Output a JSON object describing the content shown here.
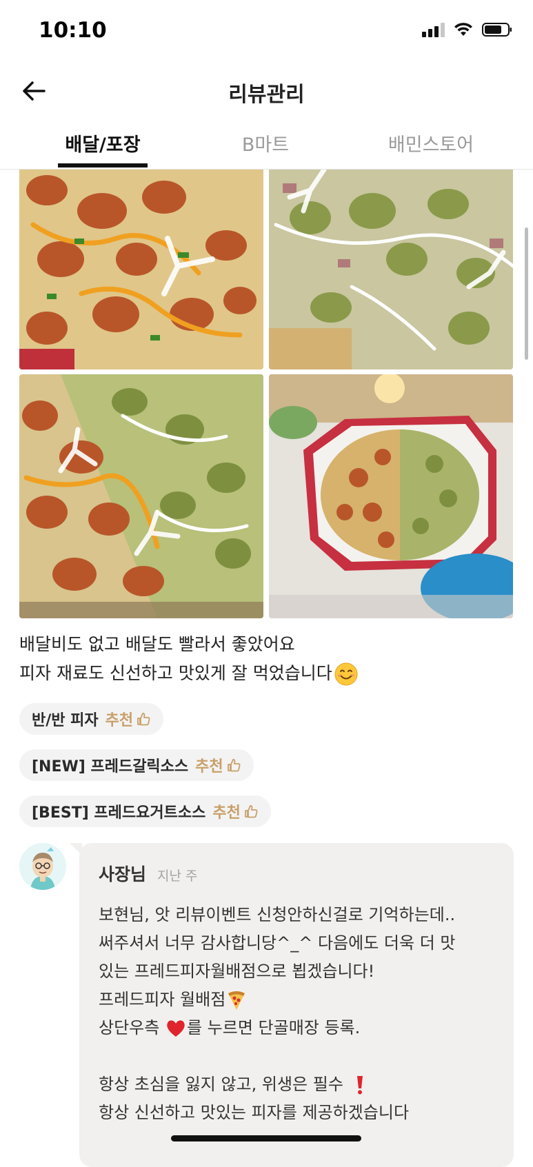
{
  "status_bar": {
    "time": "10:10"
  },
  "header": {
    "title": "리뷰관리"
  },
  "tabs": [
    {
      "label": "배달/포장",
      "active": true
    },
    {
      "label": "B마트",
      "active": false
    },
    {
      "label": "배민스토어",
      "active": false
    }
  ],
  "review": {
    "photos": [
      "shrimp-pizza-photo",
      "green-sauce-pizza-photo",
      "half-half-pizza-photo",
      "pizza-box-photo"
    ],
    "text_lines": [
      "배달비도 없고 배달도 빨라서 좋았어요",
      "피자 재료도 신선하고 맛있게 잘 먹었습니다"
    ],
    "text_emoji": "smiling-face-emoji",
    "menu_tags": [
      {
        "name": "반/반 피자",
        "recommend": "추천"
      },
      {
        "name": "[NEW] 프레드갈릭소스",
        "recommend": "추천"
      },
      {
        "name": "[BEST] 프레드요거트소스",
        "recommend": "추천"
      }
    ]
  },
  "owner_reply": {
    "author": "사장님",
    "time": "지난 주",
    "lines": [
      "보현님, 앗 리뷰이벤트 신청안하신걸로 기억하는데..",
      "써주셔서 너무 감사합니당^_^ 다음에도 더욱 더 맛",
      "있는 프레드피자월배점으로 뵙겠습니다!",
      "프레드피자 월배점",
      "상단우측 ",
      "를 누르면 단골매장 등록.",
      "",
      "항상 초심을 잃지 않고, 위생은 필수 ",
      "항상 신선하고 맛있는 피자를 제공하겠습니다"
    ]
  },
  "colors": {
    "accent_recommend": "#c8a06a",
    "tag_background": "#f3f3f3",
    "reply_background": "#f2f0ee",
    "tab_inactive": "#9a9a9a"
  }
}
